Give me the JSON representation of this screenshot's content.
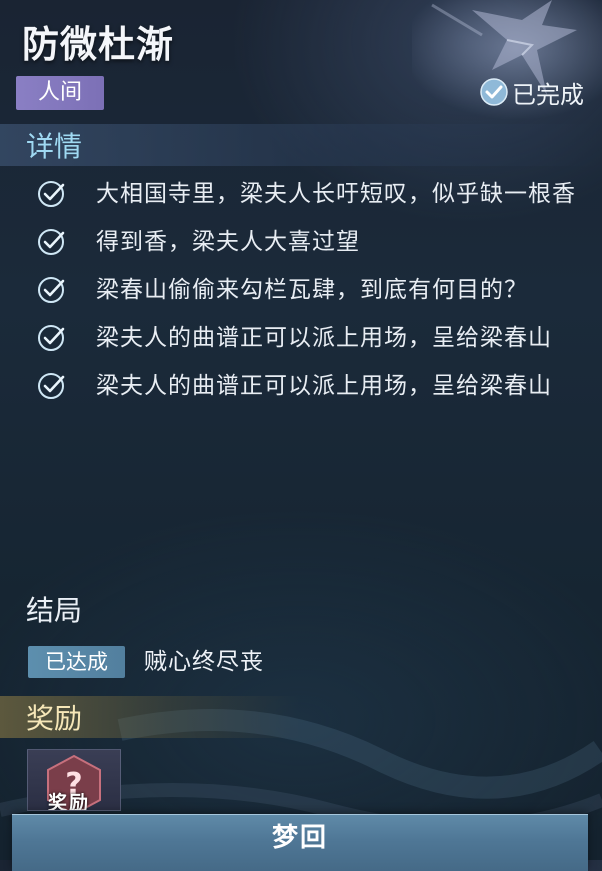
{
  "quest": {
    "title": "防微杜渐",
    "realm_tag": "人间",
    "status_text": "已完成"
  },
  "details": {
    "heading": "详情",
    "tasks": [
      {
        "text": "大相国寺里，梁夫人长吁短叹，似乎缺一根香"
      },
      {
        "text": "得到香，梁夫人大喜过望"
      },
      {
        "text": " 梁春山偷偷来勾栏瓦肆，到底有何目的？"
      },
      {
        "text": "梁夫人的曲谱正可以派上用场，呈给梁春山"
      },
      {
        "text": "梁夫人的曲谱正可以派上用场，呈给梁春山"
      }
    ]
  },
  "ending": {
    "heading": "结局",
    "badge": "已达成",
    "text": "贼心终尽丧"
  },
  "rewards": {
    "heading": "奖励",
    "item_label": "奖励"
  },
  "button": {
    "label": "梦回"
  },
  "colors": {
    "details_heading": "#9fd9f2",
    "realm_tag_bg": "#8a7fc4",
    "badge_bg": "#5d8fae",
    "button_bg": "#4f7796",
    "check": "#cfe7f5"
  },
  "icons": {
    "task_check": "check-circle-icon",
    "status": "check-badge-icon",
    "reward": "question-mark-icon"
  }
}
